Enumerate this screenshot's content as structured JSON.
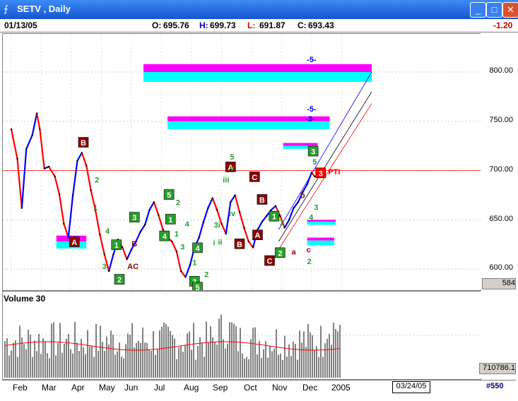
{
  "window": {
    "title": "SETV , Daily",
    "buttons": [
      "_",
      "□",
      "✕"
    ]
  },
  "quote": {
    "date": "01/13/05",
    "open_label": "O:",
    "open": "695.76",
    "high_label": "H:",
    "high": "699.73",
    "low_label": "L:",
    "low": "691.87",
    "close_label": "C:",
    "close": "693.43",
    "change": "-1.20"
  },
  "colors": {
    "up": "#0000ff",
    "down": "#ff0000",
    "zone_top": "#ff00ff",
    "zone_bottom": "#00ffff",
    "label_green": "#2a9d2a",
    "label_red": "#8b0000"
  },
  "chart_data": {
    "type": "line",
    "price_axis": {
      "ticks": [
        "800.00",
        "750.00",
        "700.00",
        "650.00",
        "600.00"
      ],
      "last_price": "584"
    },
    "x_ticks": [
      "Feb",
      "Mar",
      "Apr",
      "May",
      "Jun",
      "Jul",
      "Aug",
      "Sep",
      "Oct",
      "Nov",
      "Dec",
      "2005"
    ],
    "cursor_date": "03/24/05",
    "symbol_id": "#550",
    "price_series": [
      {
        "m": 0.0,
        "p": 742
      },
      {
        "m": 0.2,
        "p": 712
      },
      {
        "m": 0.35,
        "p": 662
      },
      {
        "m": 0.5,
        "p": 722
      },
      {
        "m": 0.7,
        "p": 736
      },
      {
        "m": 0.85,
        "p": 758
      },
      {
        "m": 0.95,
        "p": 742
      },
      {
        "m": 1.1,
        "p": 702
      },
      {
        "m": 1.25,
        "p": 704
      },
      {
        "m": 1.45,
        "p": 694
      },
      {
        "m": 1.6,
        "p": 676
      },
      {
        "m": 1.75,
        "p": 646
      },
      {
        "m": 1.9,
        "p": 632
      },
      {
        "m": 2.05,
        "p": 675
      },
      {
        "m": 2.2,
        "p": 710
      },
      {
        "m": 2.35,
        "p": 718
      },
      {
        "m": 2.5,
        "p": 705
      },
      {
        "m": 2.65,
        "p": 680
      },
      {
        "m": 2.8,
        "p": 660
      },
      {
        "m": 2.95,
        "p": 635
      },
      {
        "m": 3.1,
        "p": 615
      },
      {
        "m": 3.25,
        "p": 598
      },
      {
        "m": 3.4,
        "p": 615
      },
      {
        "m": 3.55,
        "p": 630
      },
      {
        "m": 3.7,
        "p": 622
      },
      {
        "m": 3.85,
        "p": 610
      },
      {
        "m": 4.0,
        "p": 620
      },
      {
        "m": 4.15,
        "p": 628
      },
      {
        "m": 4.3,
        "p": 638
      },
      {
        "m": 4.45,
        "p": 645
      },
      {
        "m": 4.6,
        "p": 660
      },
      {
        "m": 4.75,
        "p": 668
      },
      {
        "m": 4.9,
        "p": 655
      },
      {
        "m": 5.05,
        "p": 640
      },
      {
        "m": 5.2,
        "p": 632
      },
      {
        "m": 5.35,
        "p": 628
      },
      {
        "m": 5.5,
        "p": 618
      },
      {
        "m": 5.65,
        "p": 598
      },
      {
        "m": 5.8,
        "p": 592
      },
      {
        "m": 5.95,
        "p": 604
      },
      {
        "m": 6.1,
        "p": 622
      },
      {
        "m": 6.25,
        "p": 632
      },
      {
        "m": 6.4,
        "p": 648
      },
      {
        "m": 6.55,
        "p": 662
      },
      {
        "m": 6.7,
        "p": 672
      },
      {
        "m": 6.85,
        "p": 660
      },
      {
        "m": 7.0,
        "p": 646
      },
      {
        "m": 7.15,
        "p": 636
      },
      {
        "m": 7.3,
        "p": 668
      },
      {
        "m": 7.45,
        "p": 675
      },
      {
        "m": 7.6,
        "p": 658
      },
      {
        "m": 7.75,
        "p": 642
      },
      {
        "m": 7.9,
        "p": 628
      },
      {
        "m": 8.05,
        "p": 622
      },
      {
        "m": 8.2,
        "p": 640
      },
      {
        "m": 8.35,
        "p": 648
      },
      {
        "m": 8.5,
        "p": 654
      },
      {
        "m": 8.65,
        "p": 660
      },
      {
        "m": 8.8,
        "p": 664
      },
      {
        "m": 8.95,
        "p": 654
      },
      {
        "m": 9.1,
        "p": 642
      },
      {
        "m": 9.25,
        "p": 650
      },
      {
        "m": 9.4,
        "p": 662
      },
      {
        "m": 9.55,
        "p": 668
      },
      {
        "m": 9.7,
        "p": 678
      },
      {
        "m": 9.85,
        "p": 686
      },
      {
        "m": 10.0,
        "p": 698
      },
      {
        "m": 10.1,
        "p": 694
      }
    ],
    "resistance_line": 700,
    "zones": [
      {
        "from": 4.4,
        "to": 12.0,
        "top": 808,
        "mid": 800,
        "bottom": 790
      },
      {
        "from": 5.2,
        "to": 10.6,
        "top": 755,
        "mid": 750,
        "bottom": 742
      },
      {
        "from": 9.05,
        "to": 10.2,
        "top": 728,
        "mid": 725,
        "bottom": 722
      },
      {
        "from": 1.5,
        "to": 2.5,
        "top": 634,
        "mid": 628,
        "bottom": 621
      },
      {
        "from": 9.85,
        "to": 10.8,
        "top": 650,
        "mid": 648,
        "bottom": 645
      },
      {
        "from": 9.85,
        "to": 10.75,
        "top": 632,
        "mid": 629,
        "bottom": 624
      }
    ],
    "wave_labels": [
      {
        "t": "-5-",
        "c": "#0000ff",
        "m": 10.0,
        "p": 810,
        "box": false
      },
      {
        "t": "-5-",
        "c": "#0000ff",
        "m": 10.0,
        "p": 760,
        "box": false
      },
      {
        "t": "-3-",
        "c": "#0000ff",
        "m": 9.95,
        "p": 750,
        "box": false
      },
      {
        "t": "B",
        "c": "#8b0000",
        "m": 2.4,
        "p": 728,
        "box": true
      },
      {
        "t": "A",
        "c": "#8b0000",
        "m": 2.1,
        "p": 627,
        "box": true
      },
      {
        "t": "1",
        "c": "#2a9d2a",
        "m": 3.5,
        "p": 624,
        "box": true
      },
      {
        "t": "2",
        "c": "#2a9d2a",
        "m": 3.6,
        "p": 589,
        "box": true
      },
      {
        "t": "3",
        "c": "#2a9d2a",
        "m": 4.1,
        "p": 652,
        "box": true
      },
      {
        "t": "4",
        "c": "#2a9d2a",
        "m": 5.1,
        "p": 633,
        "box": true
      },
      {
        "t": "5",
        "c": "#2a9d2a",
        "m": 5.25,
        "p": 675,
        "box": true
      },
      {
        "t": "1",
        "c": "#2a9d2a",
        "m": 5.3,
        "p": 650,
        "box": true
      },
      {
        "t": "4",
        "c": "#2a9d2a",
        "m": 6.2,
        "p": 621,
        "box": true
      },
      {
        "t": "3",
        "c": "#2a9d2a",
        "m": 6.1,
        "p": 587,
        "box": true
      },
      {
        "t": "5",
        "c": "#2a9d2a",
        "m": 6.2,
        "p": 581,
        "box": true
      },
      {
        "t": "A",
        "c": "#8b0000",
        "m": 7.3,
        "p": 703,
        "box": true
      },
      {
        "t": "C",
        "c": "#8b0000",
        "m": 8.1,
        "p": 693,
        "box": true
      },
      {
        "t": "B",
        "c": "#8b0000",
        "m": 8.35,
        "p": 670,
        "box": true
      },
      {
        "t": "A",
        "c": "#8b0000",
        "m": 8.2,
        "p": 634,
        "box": true
      },
      {
        "t": "B",
        "c": "#8b0000",
        "m": 7.6,
        "p": 625,
        "box": true
      },
      {
        "t": "C",
        "c": "#8b0000",
        "m": 8.6,
        "p": 608,
        "box": true
      },
      {
        "t": "1",
        "c": "#2a9d2a",
        "m": 8.75,
        "p": 653,
        "box": true
      },
      {
        "t": "2",
        "c": "#2a9d2a",
        "m": 8.95,
        "p": 616,
        "box": true
      },
      {
        "t": "3",
        "c": "#2a9d2a",
        "m": 10.05,
        "p": 719,
        "box": true
      },
      {
        "t": "3",
        "c": "#ff0000",
        "m": 10.3,
        "p": 697,
        "box": true
      },
      {
        "t": "2",
        "c": "#2a9d2a",
        "m": 2.85,
        "p": 688,
        "box": false
      },
      {
        "t": "1",
        "c": "#2a9d2a",
        "m": 2.8,
        "p": 660,
        "box": false
      },
      {
        "t": "4",
        "c": "#2a9d2a",
        "m": 3.2,
        "p": 636,
        "box": false
      },
      {
        "t": "3",
        "c": "#2a9d2a",
        "m": 3.1,
        "p": 600,
        "box": false
      },
      {
        "t": "B",
        "c": "#8b0000",
        "m": 4.1,
        "p": 623,
        "box": false
      },
      {
        "t": "AC",
        "c": "#8b0000",
        "m": 4.05,
        "p": 600,
        "box": false
      },
      {
        "t": "2",
        "c": "#2a9d2a",
        "m": 5.55,
        "p": 665,
        "box": false
      },
      {
        "t": "4",
        "c": "#2a9d2a",
        "m": 5.85,
        "p": 643,
        "box": false
      },
      {
        "t": "1",
        "c": "#2a9d2a",
        "m": 5.5,
        "p": 633,
        "box": false
      },
      {
        "t": "3",
        "c": "#2a9d2a",
        "m": 5.7,
        "p": 620,
        "box": false
      },
      {
        "t": "1",
        "c": "#2a9d2a",
        "m": 6.1,
        "p": 604,
        "box": false
      },
      {
        "t": "2",
        "c": "#2a9d2a",
        "m": 6.5,
        "p": 592,
        "box": false
      },
      {
        "t": "5",
        "c": "#2a9d2a",
        "m": 7.35,
        "p": 711,
        "box": false
      },
      {
        "t": "v",
        "c": "#2a9d2a",
        "m": 7.35,
        "p": 700,
        "box": false
      },
      {
        "t": "iii",
        "c": "#2a9d2a",
        "m": 7.15,
        "p": 688,
        "box": false
      },
      {
        "t": "iv",
        "c": "#2a9d2a",
        "m": 7.35,
        "p": 654,
        "box": false
      },
      {
        "t": "3i",
        "c": "#2a9d2a",
        "m": 6.85,
        "p": 642,
        "box": false
      },
      {
        "t": "ii",
        "c": "#2a9d2a",
        "m": 6.95,
        "p": 625,
        "box": false
      },
      {
        "t": "i",
        "c": "#2a9d2a",
        "m": 6.75,
        "p": 624,
        "box": false
      },
      {
        "t": "a",
        "c": "#8b0000",
        "m": 9.4,
        "p": 615,
        "box": false
      },
      {
        "t": "b",
        "c": "#8b0000",
        "m": 9.7,
        "p": 672,
        "box": false
      },
      {
        "t": "c",
        "c": "#8b0000",
        "m": 9.9,
        "p": 617,
        "box": false
      },
      {
        "t": "2",
        "c": "#2a9d2a",
        "m": 9.92,
        "p": 605,
        "box": false
      },
      {
        "t": "3",
        "c": "#2a9d2a",
        "m": 10.15,
        "p": 660,
        "box": false
      },
      {
        "t": "4",
        "c": "#2a9d2a",
        "m": 9.98,
        "p": 650,
        "box": false
      },
      {
        "t": "1",
        "c": "#2a9d2a",
        "m": 9.0,
        "p": 645,
        "box": false
      },
      {
        "t": "5",
        "c": "#2a9d2a",
        "m": 10.1,
        "p": 706,
        "box": false
      },
      {
        "t": "PTI",
        "c": "#ff0000",
        "m": 10.75,
        "p": 696,
        "box": false
      }
    ],
    "channel_lines": [
      {
        "c": "#0000ff",
        "m1": 8.9,
        "p1": 640,
        "m2": 12.0,
        "p2": 800
      },
      {
        "c": "#000000",
        "m1": 8.9,
        "p1": 628,
        "m2": 12.0,
        "p2": 780
      },
      {
        "c": "#ff0000",
        "m1": 8.9,
        "p1": 620,
        "m2": 12.0,
        "p2": 768
      }
    ]
  },
  "volume": {
    "title": "Volume 30",
    "last_value": "710786.1"
  }
}
